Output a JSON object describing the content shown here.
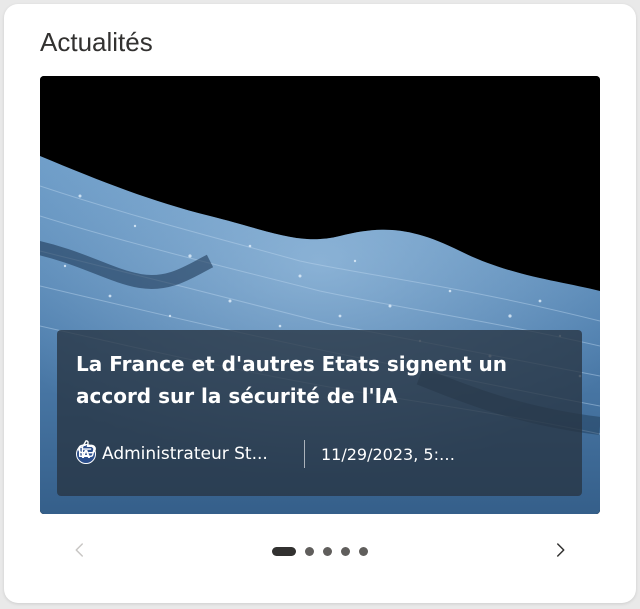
{
  "widget": {
    "title": "Actualités"
  },
  "news": {
    "headline": "La France et d'autres Etats signent un accord sur la sécurité de l'IA",
    "author_initial": "A",
    "author": "Administrateur St...",
    "date": "11/29/2023, 5:2...",
    "like_icon": "thumbs-up-icon",
    "share_icon": "link-icon"
  },
  "carousel": {
    "prev_icon": "chevron-left-icon",
    "next_icon": "chevron-right-icon",
    "total_slides": 5,
    "active_slide": 1
  },
  "colors": {
    "overlay": "#283442",
    "title_text": "#323130",
    "prev_disabled": "#c8c6c4",
    "next_enabled": "#323130",
    "avatar_bg": "#2b4e8c"
  }
}
